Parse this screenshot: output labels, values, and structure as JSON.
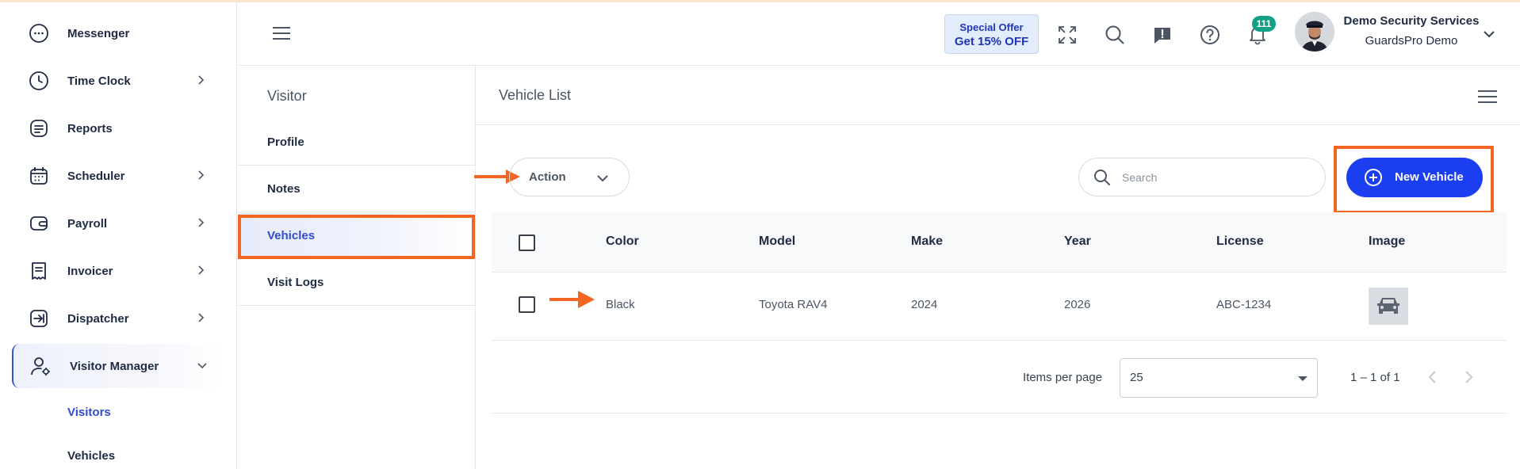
{
  "sidebar": {
    "items": [
      {
        "label": "Messenger",
        "icon": "chat-bubble-icon",
        "has_chevron": false
      },
      {
        "label": "Time Clock",
        "icon": "clock-icon",
        "has_chevron": true
      },
      {
        "label": "Reports",
        "icon": "report-icon",
        "has_chevron": false
      },
      {
        "label": "Scheduler",
        "icon": "calendar-icon",
        "has_chevron": true
      },
      {
        "label": "Payroll",
        "icon": "wallet-icon",
        "has_chevron": true
      },
      {
        "label": "Invoicer",
        "icon": "receipt-icon",
        "has_chevron": true
      },
      {
        "label": "Dispatcher",
        "icon": "dispatch-icon",
        "has_chevron": true
      },
      {
        "label": "Visitor Manager",
        "icon": "user-gear-icon",
        "has_chevron": true,
        "expanded": true,
        "active": true
      }
    ],
    "sub_items": [
      {
        "label": "Visitors",
        "active": true
      },
      {
        "label": "Vehicles",
        "active": false
      }
    ]
  },
  "header": {
    "offer": {
      "line1": "Special Offer",
      "line2": "Get 15% OFF"
    },
    "notification_count": "111",
    "user": {
      "name": "Demo Security Services",
      "org": "GuardsPro Demo"
    }
  },
  "subnav": {
    "title": "Visitor",
    "items": [
      {
        "label": "Profile",
        "active": false
      },
      {
        "label": "Notes",
        "active": false
      },
      {
        "label": "Vehicles",
        "active": true
      },
      {
        "label": "Visit Logs",
        "active": false
      }
    ]
  },
  "main": {
    "title": "Vehicle List",
    "action_label": "Action",
    "search_placeholder": "Search",
    "new_button_label": "New Vehicle",
    "columns": [
      "Color",
      "Model",
      "Make",
      "Year",
      "License",
      "Image"
    ],
    "rows": [
      {
        "color": "Black",
        "model": "Toyota RAV4",
        "make": "2024",
        "year": "2026",
        "license": "ABC-1234",
        "image": "car-icon"
      }
    ],
    "items_per_page_label": "Items per page",
    "items_per_page": "25",
    "range": "1 – 1 of 1"
  },
  "colors": {
    "accent": "#1a3ef0",
    "highlight": "#f26522",
    "badge": "#12a087"
  }
}
